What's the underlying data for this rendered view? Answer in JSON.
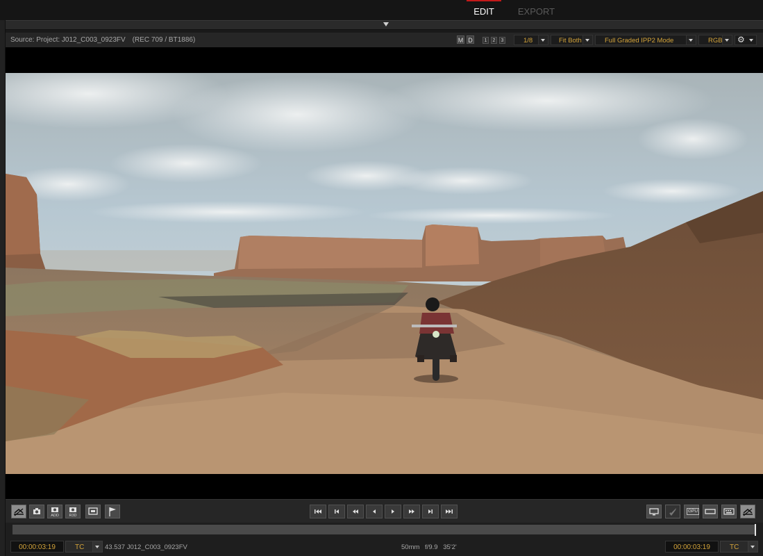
{
  "tabs": [
    {
      "label": "EDIT",
      "active": true
    },
    {
      "label": "EXPORT",
      "active": false
    }
  ],
  "viewer_header": {
    "source": "Source: Project: J012_C003_0923FV",
    "color_space": "(REC 709 / BT1886)",
    "mode_buttons": [
      "M",
      "D"
    ],
    "number_buttons": [
      "1",
      "2",
      "3"
    ],
    "resolution": "1/8",
    "fit": "Fit Both",
    "pipeline": "Full Graded IPP2 Mode",
    "channel": "RGB",
    "settings_icon": "gear-icon"
  },
  "accent_color": "#d4a43a",
  "active_tab_color": "#c41a1a",
  "transport": {
    "left_tools": [
      "toggle-overlay-icon",
      "snapshot-icon",
      "snapshot-add-icon",
      "snapshot-r3d-icon",
      "slate-icon",
      "flag-icon"
    ],
    "left_tool_labels": {
      "add": "ADD",
      "r3d": "R3D"
    },
    "playback": [
      "go-to-start-icon",
      "step-back-icon",
      "rewind-icon",
      "play-reverse-icon",
      "play-icon",
      "fast-forward-icon",
      "step-forward-icon",
      "go-to-end-icon"
    ],
    "right_tools": [
      "monitor-icon",
      "rocket-icon",
      "gpu-icon",
      "aspect-frame-icon",
      "keyboard-icon",
      "toggle-overlay-icon"
    ],
    "gpu_label": "GPU"
  },
  "status": {
    "timecode_left": "00:00:03:19",
    "tc_mode_left": "TC",
    "clip": "43.537 J012_C003_0923FV",
    "lens": "50mm",
    "aperture": "f/9.9",
    "focus": "35'2'",
    "timecode_right": "00:00:03:19",
    "tc_mode_right": "TC"
  },
  "playhead_position": 0.998
}
